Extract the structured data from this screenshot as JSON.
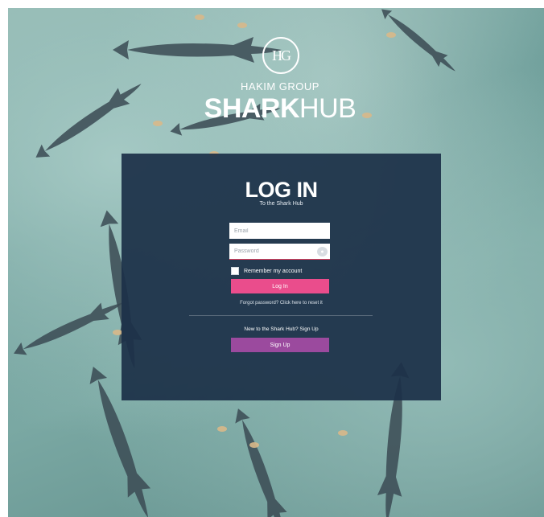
{
  "brand": {
    "logo_text": "HG",
    "small_title": "HAKIM GROUP",
    "big_title_bold": "SHARK",
    "big_title_rest": "HUB"
  },
  "login": {
    "title": "LOG IN",
    "subtitle": "To the Shark Hub",
    "email_placeholder": "Email",
    "password_placeholder": "Password",
    "remember_label": "Remember my account",
    "login_button": "Log In",
    "forgot_text": "Forgot password? Click here to reset it",
    "new_text": "New to the Shark Hub? Sign Up",
    "signup_button": "Sign Up"
  },
  "colors": {
    "panel": "#1c3048",
    "login_button": "#ea4d8c",
    "signup_button": "#9b4a9e"
  }
}
